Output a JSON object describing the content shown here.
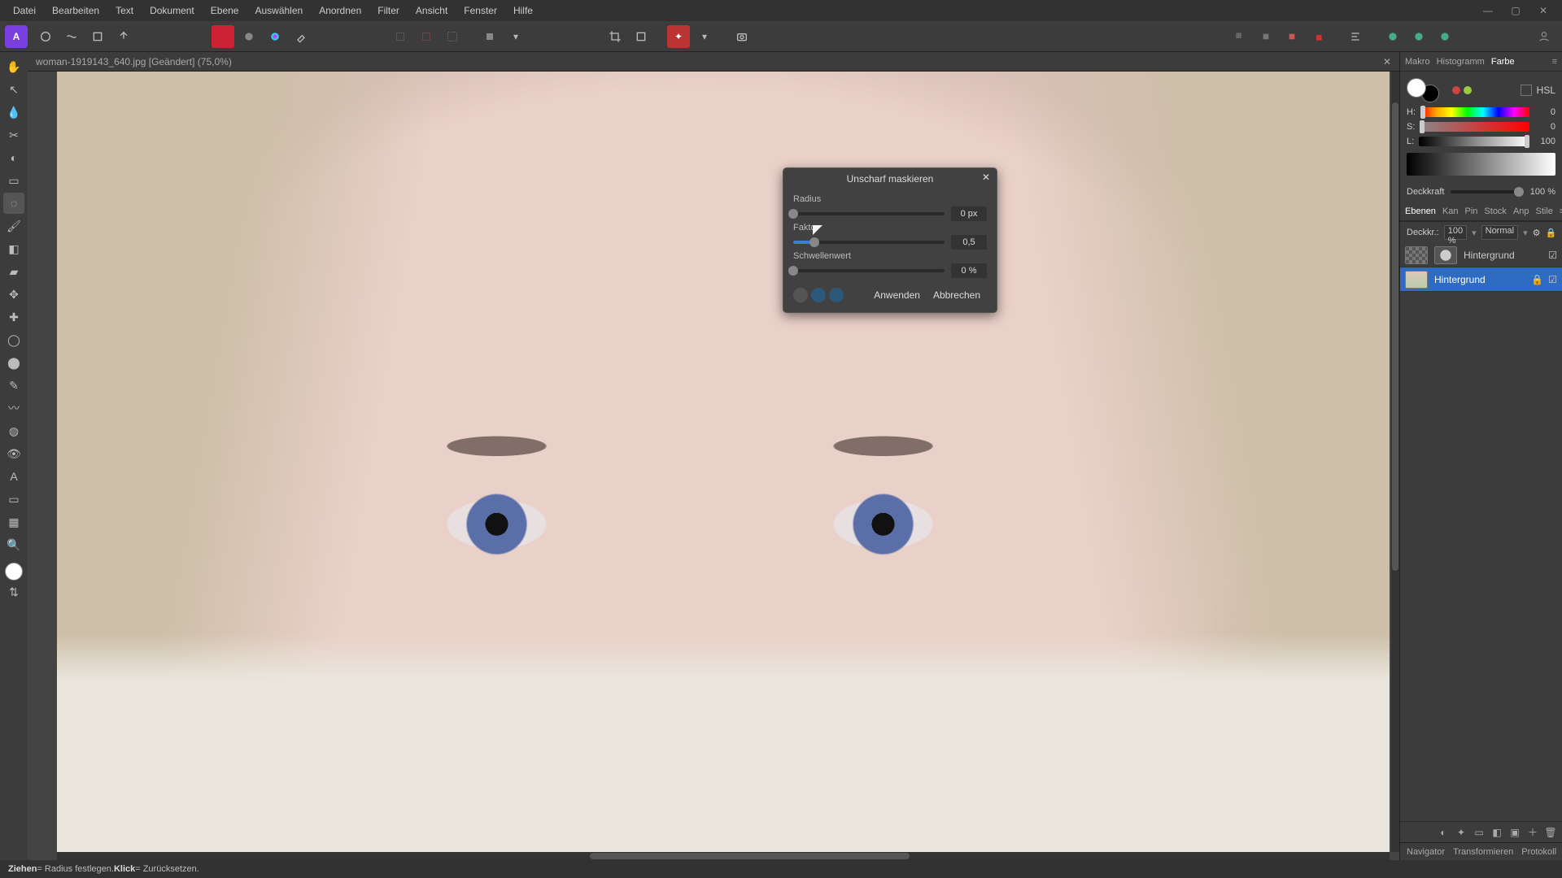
{
  "menubar": [
    "Datei",
    "Bearbeiten",
    "Text",
    "Dokument",
    "Ebene",
    "Auswählen",
    "Anordnen",
    "Filter",
    "Ansicht",
    "Fenster",
    "Hilfe"
  ],
  "window_controls": {
    "min": "—",
    "max": "▢",
    "close": "✕"
  },
  "document": {
    "tab_title": "woman-1919143_640.jpg [Geändert] (75,0%)",
    "close": "✕"
  },
  "dialog": {
    "title": "Unscharf maskieren",
    "close": "✕",
    "params": {
      "radius": {
        "label": "Radius",
        "value": "0 px",
        "pct": 0
      },
      "faktor": {
        "label": "Faktor",
        "value": "0,5",
        "pct": 14
      },
      "schwelle": {
        "label": "Schwellenwert",
        "value": "0 %",
        "pct": 0
      }
    },
    "apply": "Anwenden",
    "cancel": "Abbrechen"
  },
  "right": {
    "tabs_top": [
      "Makro",
      "Histogramm",
      "Farbe"
    ],
    "color": {
      "mode": "HSL",
      "h": {
        "label": "H:",
        "value": "0"
      },
      "s": {
        "label": "S:",
        "value": "0"
      },
      "l": {
        "label": "L:",
        "value": "100"
      }
    },
    "opacity": {
      "label": "Deckkraft",
      "value": "100 %"
    },
    "tabs_mid": [
      "Ebenen",
      "Kan",
      "Pin",
      "Stock",
      "Anp",
      "Stile"
    ],
    "layer_opacity": {
      "label": "Deckkr.:",
      "value": "100 %",
      "blend": "Normal"
    },
    "layers": [
      {
        "name": "Hintergrund",
        "selected": false,
        "mask": true
      },
      {
        "name": "Hintergrund",
        "selected": true,
        "mask": false
      }
    ],
    "tabs_bottom": [
      "Navigator",
      "Transformieren",
      "Protokoll"
    ]
  },
  "status": {
    "part1_b": "Ziehen",
    "part1_rest": " = Radius festlegen. ",
    "part2_b": "Klick",
    "part2_rest": " = Zurücksetzen."
  },
  "icons": {
    "hand": "✋",
    "arrow": "↖",
    "crop": "◫",
    "brush": "🖌",
    "erase": "◧",
    "pen": "✎",
    "lasso": "◌",
    "text": "A",
    "shape": "▭",
    "eyedrop": "⦿",
    "zoom": "🔍",
    "grad": "◧"
  }
}
